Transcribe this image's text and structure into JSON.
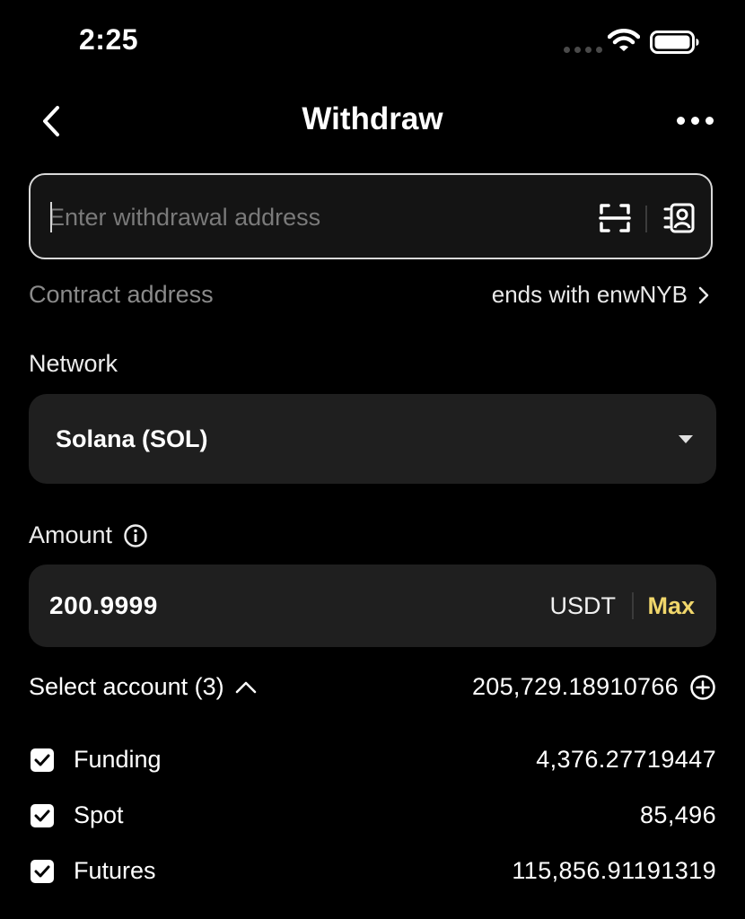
{
  "status_bar": {
    "time": "2:25"
  },
  "header": {
    "title": "Withdraw"
  },
  "address": {
    "placeholder": "Enter withdrawal address"
  },
  "contract": {
    "label": "Contract address",
    "value": "ends with enwNYB"
  },
  "network": {
    "label": "Network",
    "value": "Solana (SOL)"
  },
  "amount": {
    "label": "Amount",
    "value": "200.9999",
    "unit": "USDT",
    "max_label": "Max"
  },
  "accounts": {
    "label": "Select account (3)",
    "total": "205,729.18910766",
    "items": [
      {
        "name": "Funding",
        "value": "4,376.27719447",
        "checked": true
      },
      {
        "name": "Spot",
        "value": "85,496",
        "checked": true
      },
      {
        "name": "Futures",
        "value": "115,856.91191319",
        "checked": true
      }
    ]
  },
  "colors": {
    "background": "#000000",
    "field": "#1f1f1f",
    "accent": "#f0d66b"
  }
}
